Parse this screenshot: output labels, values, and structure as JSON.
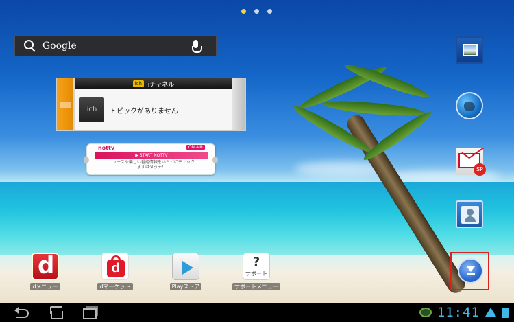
{
  "search": {
    "label": "Google"
  },
  "page_indicator": {
    "count": 3,
    "active_index": 0
  },
  "ichannel": {
    "header_logo": "ich",
    "header_title": "iチャネル",
    "thumb_text": "ich",
    "message": "トピックがありません"
  },
  "nottv": {
    "logo": "nottv",
    "on_air": "ON AIR",
    "start_label": "▶ START NOTTV",
    "description_line1": "ニュースや楽しい番組情報をいちどにチェック",
    "description_line2": "まずはタッチ！"
  },
  "right_column": {
    "mail_badge": "SP"
  },
  "dock": [
    {
      "label": "dメニュー"
    },
    {
      "label": "dマーケット"
    },
    {
      "label": "Playストア"
    },
    {
      "label": "サポートメニュー",
      "tile_mark": "?",
      "tile_text": "サポート"
    }
  ],
  "status_bar": {
    "time": "11:41"
  },
  "colors": {
    "highlight_frame": "#e0201c",
    "clock": "#3fb8e6",
    "active_dot": "#e4d94e"
  }
}
